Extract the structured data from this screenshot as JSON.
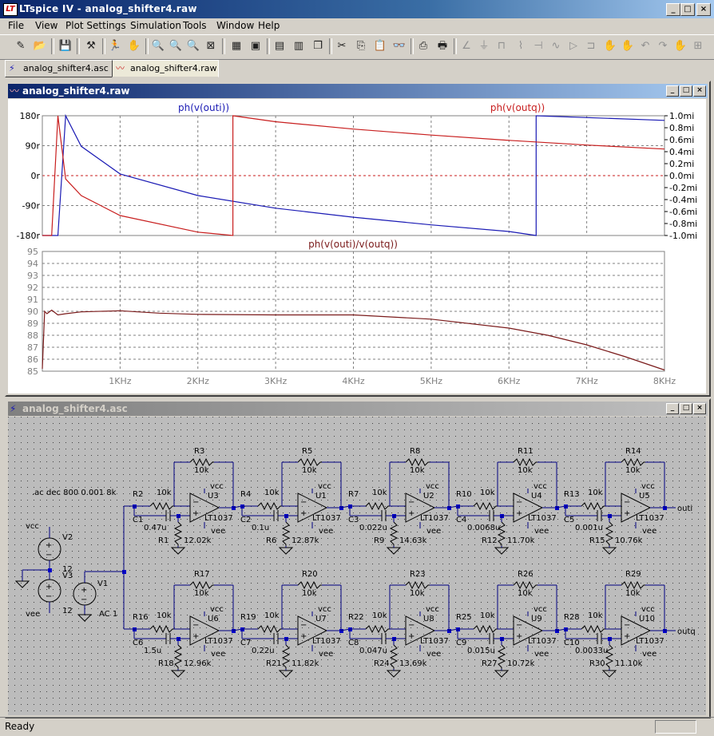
{
  "window": {
    "title": "LTspice IV - analog_shifter4.raw",
    "icon_text": "LT",
    "min_label": "_",
    "max_label": "□",
    "close_label": "×"
  },
  "menu": [
    "File",
    "View",
    "Plot Settings",
    "Simulation",
    "Tools",
    "Window",
    "Help"
  ],
  "toolbar_icons": [
    "new-schematic",
    "open",
    "save",
    "control-panel",
    "run",
    "halt",
    "zoom-in",
    "pan",
    "zoom-out",
    "zoom-fit",
    "autorange",
    "grid",
    "tile-horizontal",
    "tile-vertical",
    "cascade",
    "cut",
    "copy",
    "paste",
    "find",
    "print-setup",
    "print",
    "draw-wire",
    "ground",
    "label-net",
    "resistor",
    "capacitor",
    "inductor",
    "diode",
    "component",
    "rotate",
    "mirror",
    "drag",
    "move",
    "delete",
    "duplicate",
    "text",
    "spice-directive"
  ],
  "tabs": [
    {
      "label": "analog_shifter4.asc",
      "icon": "schematic-icon"
    },
    {
      "label": "analog_shifter4.raw",
      "icon": "waveform-icon"
    }
  ],
  "waveform_window": {
    "title": "analog_shifter4.raw",
    "top_pane": {
      "trace1_label": "ph(v(outi))",
      "trace2_label": "ph(v(outq))",
      "left_ticks": [
        "180r",
        "90r",
        "0r",
        "-90r",
        "-180r"
      ],
      "right_ticks": [
        "1.0mi",
        "0.8mi",
        "0.6mi",
        "0.4mi",
        "0.2mi",
        "0.0mi",
        "-0.2mi",
        "-0.4mi",
        "-0.6mi",
        "-0.8mi",
        "-1.0mi"
      ]
    },
    "bottom_pane": {
      "trace_label": "ph(v(outi)/v(outq))",
      "y_ticks": [
        "95",
        "94",
        "93",
        "92",
        "91",
        "90",
        "89",
        "88",
        "87",
        "86",
        "85"
      ]
    },
    "x_ticks": [
      "1KHz",
      "2KHz",
      "3KHz",
      "4KHz",
      "5KHz",
      "6KHz",
      "7KHz",
      "8KHz"
    ],
    "colors": {
      "outi": "#1a1ab4",
      "outq": "#c81e1e",
      "ratio": "#7a1a1a",
      "grid": "#808080",
      "zero": "#c81e1e"
    }
  },
  "chart_data": [
    {
      "type": "line",
      "title": "",
      "xlabel": "",
      "ylabel": "",
      "x_unit": "Hz",
      "xlim": [
        0,
        8000
      ],
      "ylim": [
        -180,
        180
      ],
      "series": [
        {
          "name": "ph(v(outi))",
          "x": [
            0,
            200,
            300,
            500,
            1000,
            2000,
            3000,
            4000,
            5000,
            6000,
            6350,
            6350,
            8000
          ],
          "values": [
            -180,
            -180,
            180,
            88,
            5,
            -60,
            -98,
            -125,
            -148,
            -168,
            -180,
            180,
            166
          ]
        },
        {
          "name": "ph(v(outq))",
          "x": [
            0,
            120,
            200,
            300,
            500,
            1000,
            2000,
            2450,
            2450,
            3000,
            4000,
            5000,
            6000,
            7000,
            8000
          ],
          "values": [
            -180,
            -180,
            180,
            -10,
            -60,
            -120,
            -170,
            -180,
            180,
            162,
            140,
            122,
            106,
            92,
            80
          ]
        }
      ]
    },
    {
      "type": "line",
      "title": "",
      "xlabel": "",
      "ylabel": "",
      "x_unit": "Hz",
      "xlim": [
        0,
        8000
      ],
      "ylim": [
        85,
        95
      ],
      "series": [
        {
          "name": "ph(v(outi)/v(outq))",
          "x": [
            0,
            30,
            60,
            120,
            200,
            300,
            500,
            1000,
            1500,
            2000,
            3000,
            4000,
            5000,
            6000,
            6500,
            7000,
            7500,
            8000
          ],
          "values": [
            85.2,
            90.0,
            89.8,
            90.1,
            89.7,
            89.8,
            89.95,
            90.05,
            89.85,
            89.75,
            89.7,
            89.7,
            89.35,
            88.6,
            88.0,
            87.2,
            86.2,
            85.1
          ]
        }
      ]
    }
  ],
  "schematic_window": {
    "title": "analog_shifter4.asc",
    "directive": ".ac dec 800 0.001 8k",
    "supplies": [
      {
        "name": "V2",
        "value": "12",
        "net": "vcc"
      },
      {
        "name": "V3",
        "value": "12",
        "net": "vee"
      },
      {
        "name": "V1",
        "value": "AC 1"
      }
    ],
    "top_row": [
      {
        "r_in": "R2",
        "r_in_val": "10k",
        "c": "C1",
        "c_val": "0.47u",
        "r_gnd": "R1",
        "r_gnd_val": "12.02k",
        "r_fb": "R3",
        "r_fb_val": "10k",
        "u": "U3"
      },
      {
        "r_in": "R4",
        "r_in_val": "10k",
        "c": "C2",
        "c_val": "0.1u",
        "r_gnd": "R6",
        "r_gnd_val": "12.87k",
        "r_fb": "R5",
        "r_fb_val": "10k",
        "u": "U1"
      },
      {
        "r_in": "R7",
        "r_in_val": "10k",
        "c": "C3",
        "c_val": "0.022u",
        "r_gnd": "R9",
        "r_gnd_val": "14.63k",
        "r_fb": "R8",
        "r_fb_val": "10k",
        "u": "U2"
      },
      {
        "r_in": "R10",
        "r_in_val": "10k",
        "c": "C4",
        "c_val": "0.0068u",
        "r_gnd": "R12",
        "r_gnd_val": "11.70k",
        "r_fb": "R11",
        "r_fb_val": "10k",
        "u": "U4"
      },
      {
        "r_in": "R13",
        "r_in_val": "10k",
        "c": "C5",
        "c_val": "0.001u",
        "r_gnd": "R15",
        "r_gnd_val": "10.76k",
        "r_fb": "R14",
        "r_fb_val": "10k",
        "u": "U5"
      }
    ],
    "bottom_row": [
      {
        "r_in": "R16",
        "r_in_val": "10k",
        "c": "C6",
        "c_val": "1.5u",
        "r_gnd": "R18",
        "r_gnd_val": "12.96k",
        "r_fb": "R17",
        "r_fb_val": "10k",
        "u": "U6"
      },
      {
        "r_in": "R19",
        "r_in_val": "10k",
        "c": "C7",
        "c_val": "0.22u",
        "r_gnd": "R21",
        "r_gnd_val": "11.82k",
        "r_fb": "R20",
        "r_fb_val": "10k",
        "u": "U7"
      },
      {
        "r_in": "R22",
        "r_in_val": "10k",
        "c": "C8",
        "c_val": "0.047u",
        "r_gnd": "R24",
        "r_gnd_val": "13.69k",
        "r_fb": "R23",
        "r_fb_val": "10k",
        "u": "U8"
      },
      {
        "r_in": "R25",
        "r_in_val": "10k",
        "c": "C9",
        "c_val": "0.015u",
        "r_gnd": "R27",
        "r_gnd_val": "10.72k",
        "r_fb": "R26",
        "r_fb_val": "10k",
        "u": "U9"
      },
      {
        "r_in": "R28",
        "r_in_val": "10k",
        "c": "C10",
        "c_val": "0.0033u",
        "r_gnd": "R30",
        "r_gnd_val": "11.10k",
        "r_fb": "R29",
        "r_fb_val": "10k",
        "u": "U10"
      }
    ],
    "opamp_model": "LT1037",
    "vcc_label": "vcc",
    "vee_label": "vee",
    "out_top": "outi",
    "out_bottom": "outq"
  },
  "status": {
    "text": "Ready"
  }
}
